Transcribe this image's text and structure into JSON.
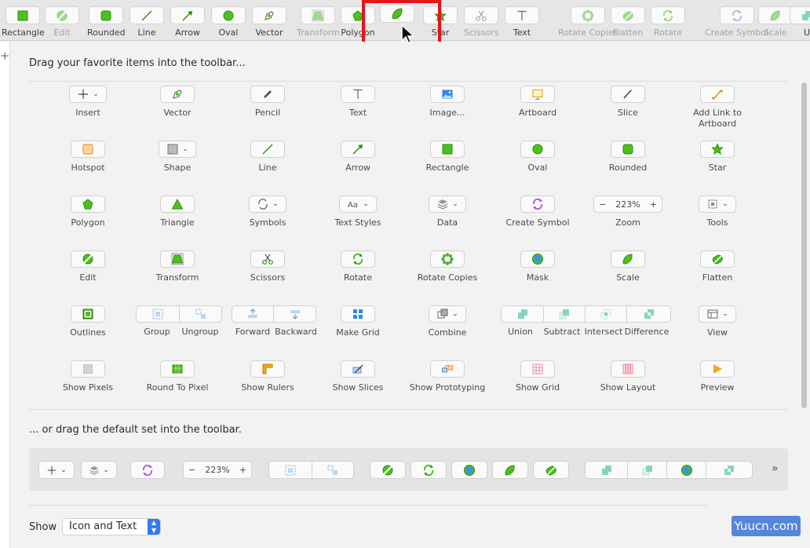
{
  "toolbar": {
    "items": [
      {
        "label": "Rectangle",
        "icon": "rectangle-icon",
        "dim": false
      },
      {
        "label": "Edit",
        "icon": "edit-icon",
        "dim": true
      },
      {
        "label": "Rounded",
        "icon": "rounded-icon",
        "dim": false
      },
      {
        "label": "Line",
        "icon": "line-icon",
        "dim": false
      },
      {
        "label": "Arrow",
        "icon": "arrow-icon",
        "dim": false
      },
      {
        "label": "Oval",
        "icon": "oval-icon",
        "dim": false
      },
      {
        "label": "Vector",
        "icon": "vector-icon",
        "dim": false
      },
      {
        "label": "Transform",
        "icon": "transform-icon",
        "dim": true
      },
      {
        "label": "Polygon",
        "icon": "polygon-icon",
        "dim": false
      },
      {
        "label": "Star",
        "icon": "star-icon",
        "dim": false
      },
      {
        "label": "Scissors",
        "icon": "scissors-icon",
        "dim": true
      },
      {
        "label": "Text",
        "icon": "text-icon",
        "dim": false
      },
      {
        "label": "Rotate Copies",
        "icon": "rotate-copies-icon",
        "dim": true
      },
      {
        "label": "Flatten",
        "icon": "flatten-icon",
        "dim": true
      },
      {
        "label": "Rotate",
        "icon": "rotate-icon",
        "dim": true
      },
      {
        "label": "Create Symbol",
        "icon": "create-symbol-icon",
        "dim": true
      },
      {
        "label": "Scale",
        "icon": "scale-icon",
        "dim": true
      },
      {
        "label": "U",
        "icon": "union-icon",
        "dim": false
      }
    ],
    "dragging_icon": "scale-icon"
  },
  "panel": {
    "heading": "Drag your favorite items into the toolbar...",
    "default_heading": "... or drag the default set into the toolbar.",
    "grid": [
      [
        {
          "label": "Insert",
          "icon": "plus-icon",
          "chev": true
        },
        {
          "label": "Vector",
          "icon": "vector-icon"
        },
        {
          "label": "Pencil",
          "icon": "pencil-icon"
        },
        {
          "label": "Text",
          "icon": "text-icon"
        },
        {
          "label": "Image...",
          "icon": "image-icon"
        },
        {
          "label": "Artboard",
          "icon": "artboard-icon"
        },
        {
          "label": "Slice",
          "icon": "slice-icon"
        },
        {
          "label": "Add Link to Artboard",
          "icon": "link-icon"
        }
      ],
      [
        {
          "label": "Hotspot",
          "icon": "hotspot-icon"
        },
        {
          "label": "Shape",
          "icon": "shape-icon",
          "chev": true
        },
        {
          "label": "Line",
          "icon": "line-icon"
        },
        {
          "label": "Arrow",
          "icon": "arrow-icon"
        },
        {
          "label": "Rectangle",
          "icon": "rectangle-icon"
        },
        {
          "label": "Oval",
          "icon": "oval-icon"
        },
        {
          "label": "Rounded",
          "icon": "rounded-icon"
        },
        {
          "label": "Star",
          "icon": "star-icon"
        }
      ],
      [
        {
          "label": "Polygon",
          "icon": "polygon-icon"
        },
        {
          "label": "Triangle",
          "icon": "triangle-icon"
        },
        {
          "label": "Symbols",
          "icon": "symbols-icon",
          "chev": true
        },
        {
          "label": "Text Styles",
          "icon": "text-styles-icon",
          "chev": true
        },
        {
          "label": "Data",
          "icon": "data-icon",
          "chev": true
        },
        {
          "label": "Create Symbol",
          "icon": "create-symbol-icon"
        },
        {
          "label": "Zoom",
          "icon": "zoom-control",
          "zoom": true
        },
        {
          "label": "Tools",
          "icon": "tools-icon",
          "chev": true
        }
      ],
      [
        {
          "label": "Edit",
          "icon": "edit-icon"
        },
        {
          "label": "Transform",
          "icon": "transform-icon"
        },
        {
          "label": "Scissors",
          "icon": "scissors-icon"
        },
        {
          "label": "Rotate",
          "icon": "rotate-icon"
        },
        {
          "label": "Rotate Copies",
          "icon": "rotate-copies-icon"
        },
        {
          "label": "Mask",
          "icon": "mask-icon"
        },
        {
          "label": "Scale",
          "icon": "scale-icon"
        },
        {
          "label": "Flatten",
          "icon": "flatten-icon"
        }
      ],
      [
        {
          "label": "Outlines",
          "icon": "outlines-icon"
        },
        {
          "label": "",
          "icon": "",
          "skip": true
        },
        {
          "label": "",
          "icon": "",
          "skip": true
        },
        {
          "label": "Make Grid",
          "icon": "make-grid-icon"
        },
        {
          "label": "Combine",
          "icon": "combine-icon",
          "chev": true
        },
        {
          "label": "",
          "icon": "",
          "skip": true
        },
        {
          "label": "",
          "icon": "",
          "skip": true
        },
        {
          "label": "View",
          "icon": "view-icon",
          "chev": true
        }
      ],
      [
        {
          "label": "Show Pixels",
          "icon": "show-pixels-icon"
        },
        {
          "label": "Round To Pixel",
          "icon": "round-pixel-icon"
        },
        {
          "label": "Show Rulers",
          "icon": "rulers-icon"
        },
        {
          "label": "Show Slices",
          "icon": "show-slices-icon"
        },
        {
          "label": "Show Prototyping",
          "icon": "prototyping-icon"
        },
        {
          "label": "Show Grid",
          "icon": "show-grid-icon"
        },
        {
          "label": "Show Layout",
          "icon": "show-layout-icon"
        },
        {
          "label": "Preview",
          "icon": "preview-icon"
        }
      ]
    ],
    "zoom_value": "223%",
    "zoom_minus": "−",
    "zoom_plus": "+",
    "groups": [
      {
        "labels": [
          "Group",
          "Ungroup"
        ],
        "icons": [
          "group-icon",
          "ungroup-icon"
        ]
      },
      {
        "labels": [
          "Forward",
          "Backward"
        ],
        "icons": [
          "forward-icon",
          "backward-icon"
        ]
      },
      {
        "labels": [
          "Union",
          "Subtract",
          "Intersect",
          "Difference"
        ],
        "icons": [
          "union-icon",
          "subtract-icon",
          "intersect-icon",
          "difference-icon"
        ]
      }
    ]
  },
  "default_set": {
    "zoom_value": "223%",
    "more": "»"
  },
  "show": {
    "label": "Show",
    "value": "Icon and Text"
  },
  "watermark": "Yuucn.com",
  "colors": {
    "accent": "#4cc21b",
    "accent_dark": "#2f8a0e",
    "highlight": "#e4141b",
    "select_blue": "#3478f6"
  }
}
